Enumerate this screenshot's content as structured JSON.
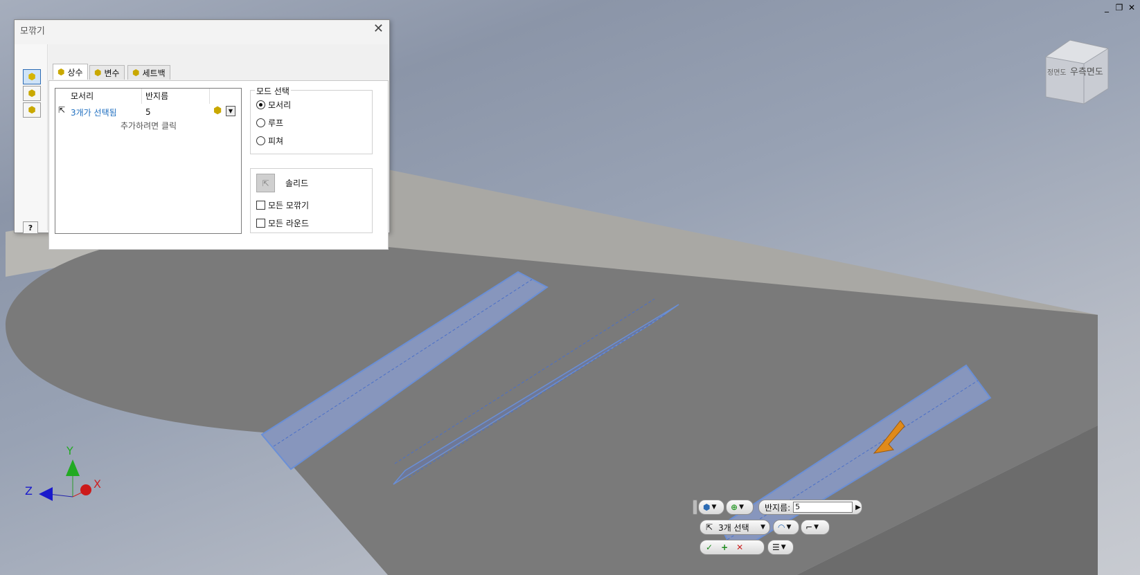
{
  "window_controls": [
    "_",
    "❐",
    "✕"
  ],
  "dialog": {
    "title": "모깎기",
    "tabs": [
      {
        "label": "상수"
      },
      {
        "label": "변수"
      },
      {
        "label": "세트백"
      }
    ],
    "table": {
      "col_edges": "모서리",
      "col_radius": "반지름",
      "row_edges": "3개가 선택됨",
      "row_radius": "5",
      "add_hint": "추가하려면 클릭"
    },
    "mode": {
      "legend": "모드 선택",
      "options": [
        "모서리",
        "루프",
        "피쳐"
      ],
      "selected": "모서리"
    },
    "solid_label": "솔리드",
    "all_fillets": "모든 모깎기",
    "all_rounds": "모든 라운드",
    "help_icon": "?"
  },
  "viewcube": {
    "face_right": "우측면도",
    "face_front": "정면도"
  },
  "triad": {
    "x": "X",
    "y": "Y",
    "z": "Z"
  },
  "minitoolbar": {
    "radius_label": "반지름:",
    "radius_value": "5",
    "selection_label": "3개 선택"
  },
  "colors": {
    "accent": "#2c6bb4",
    "fillet_blue": "#6a8fd6",
    "arrow": "#e08a1a"
  }
}
